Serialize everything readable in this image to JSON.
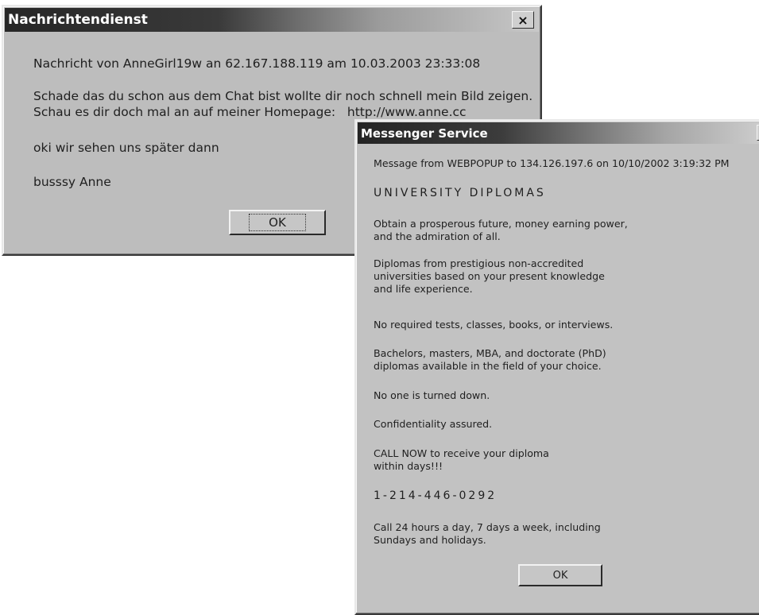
{
  "german_dialog": {
    "title": "Nachrichtendienst",
    "close_label": "×",
    "header": "Nachricht von AnneGirl19w an 62.167.188.119 am 10.03.2003 23:33:08",
    "line1": "Schade das du schon aus dem Chat bist wollte dir noch schnell mein Bild zeigen.",
    "line2": "Schau es dir doch mal an auf meiner Homepage:   http://www.anne.cc",
    "line3": "oki wir sehen uns später dann",
    "line4": "busssy Anne",
    "ok_label": "OK"
  },
  "english_dialog": {
    "title": "Messenger Service",
    "close_label": "×",
    "header": "Message from WEBPOPUP to 134.126.197.6 on 10/10/2002 3:19:32 PM",
    "heading": "UNIVERSITY DIPLOMAS",
    "p1a": "Obtain a prosperous future, money earning power,",
    "p1b": "and the admiration of all.",
    "p2a": "Diplomas from prestigious non-accredited",
    "p2b": "universities based on your present knowledge",
    "p2c": "and life experience.",
    "p3": "No required tests, classes, books, or interviews.",
    "p4a": "Bachelors, masters, MBA, and doctorate (PhD)",
    "p4b": "diplomas available in the field of your choice.",
    "p5": "No one is turned down.",
    "p6": "Confidentiality assured.",
    "p7a": "CALL NOW to receive your diploma",
    "p7b": "within days!!!",
    "phone": "1-214-446-0292",
    "p8a": "Call 24 hours a day, 7 days a week, including",
    "p8b": "Sundays and holidays.",
    "ok_label": "OK"
  }
}
